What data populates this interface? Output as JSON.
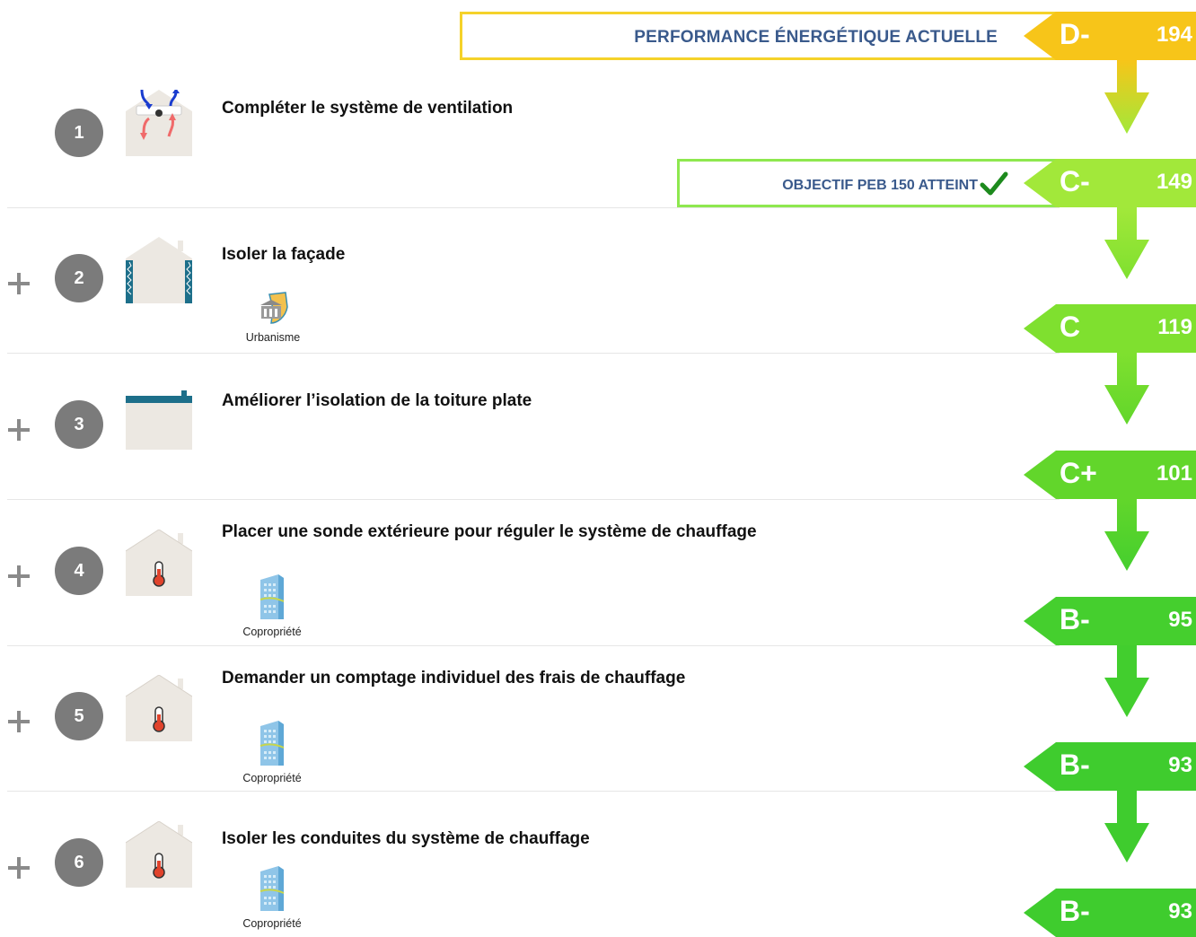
{
  "header": {
    "title": "PERFORMANCE ÉNERGÉTIQUE ACTUELLE"
  },
  "objective": {
    "text": "OBJECTIF PEB 150 ATTEINT",
    "check_icon": "check-icon"
  },
  "colors": {
    "D-": "#f7c519",
    "C-": "#a2e83a",
    "C": "#7fe02f",
    "C+": "#62d62b",
    "B-": "#3fcc2e",
    "header_border": "#f5d22a",
    "objective_border": "#8ee84f",
    "text_blue": "#3a5a8c",
    "circle_gray": "#7b7b7b"
  },
  "labels": [
    {
      "grade": "D-",
      "value": "194",
      "color": "#f7c519"
    },
    {
      "grade": "C-",
      "value": "149",
      "color": "#a2e83a"
    },
    {
      "grade": "C",
      "value": "119",
      "color": "#7fe02f"
    },
    {
      "grade": "C+",
      "value": "101",
      "color": "#62d62b"
    },
    {
      "grade": "B-",
      "value": "95",
      "color": "#45cf2e"
    },
    {
      "grade": "B-",
      "value": "93",
      "color": "#3fcc2e"
    },
    {
      "grade": "B-",
      "value": "93",
      "color": "#3fcc2e"
    }
  ],
  "steps": [
    {
      "number": "1",
      "title": "Compléter le système de ventilation",
      "icon": "ventilation-icon"
    },
    {
      "number": "2",
      "title": "Isoler la façade",
      "icon": "facade-insulation-icon",
      "badge": "Urbanisme",
      "badge_icon": "urbanisme-icon"
    },
    {
      "number": "3",
      "title": "Améliorer l’isolation de la toiture plate",
      "icon": "flat-roof-icon"
    },
    {
      "number": "4",
      "title": "Placer une sonde extérieure pour réguler le système de chauffage",
      "icon": "thermometer-house-icon",
      "badge": "Copropriété",
      "badge_icon": "building-icon"
    },
    {
      "number": "5",
      "title": "Demander un comptage individuel des frais de chauffage",
      "icon": "thermometer-house-icon",
      "badge": "Copropriété",
      "badge_icon": "building-icon"
    },
    {
      "number": "6",
      "title": "Isoler les conduites du système de chauffage",
      "icon": "thermometer-house-icon",
      "badge": "Copropriété",
      "badge_icon": "building-icon"
    }
  ]
}
